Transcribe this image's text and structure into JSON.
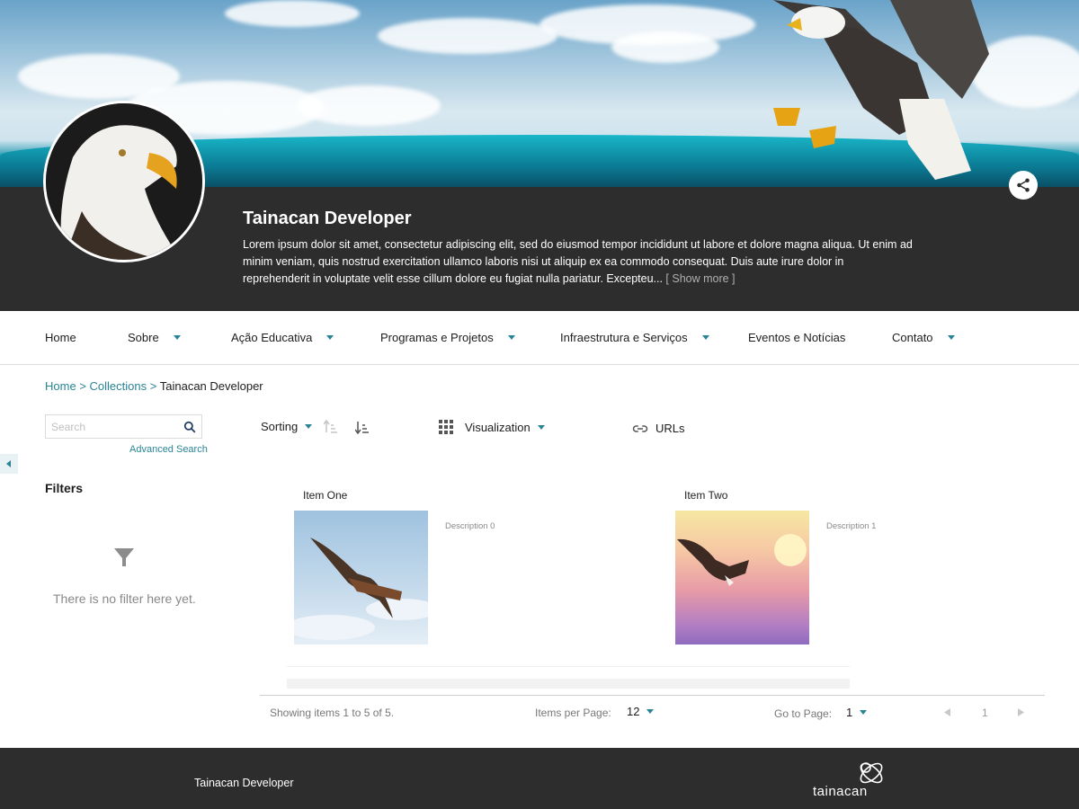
{
  "collection": {
    "title": "Tainacan Developer",
    "description": "Lorem ipsum dolor sit amet, consectetur adipiscing elit, sed do eiusmod tempor incididunt ut labore et dolore magna aliqua. Ut enim ad minim veniam, quis nostrud exercitation ullamco laboris nisi ut aliquip ex ea commodo consequat. Duis aute irure dolor in reprehenderit in voluptate velit esse cillum dolore eu fugiat nulla pariatur. Excepteu...",
    "show_more": "[ Show more ]"
  },
  "nav": {
    "home": "Home",
    "sobre": "Sobre",
    "acao": "Ação Educativa",
    "programas": "Programas e Projetos",
    "infra": "Infraestrutura e Serviços",
    "eventos": "Eventos e Notícias",
    "contato": "Contato"
  },
  "breadcrumb": {
    "home": "Home",
    "collections": "Collections",
    "current": "Tainacan Developer",
    "sep": ">"
  },
  "search": {
    "placeholder": "Search",
    "advanced": "Advanced Search"
  },
  "filters": {
    "title": "Filters",
    "empty": "There is no filter here yet."
  },
  "toolbar": {
    "sorting": "Sorting",
    "visualization": "Visualization",
    "urls": "URLs"
  },
  "items": [
    {
      "title": "Item One",
      "description": "Description 0"
    },
    {
      "title": "Item Two",
      "description": "Description 1"
    }
  ],
  "pagination": {
    "showing": "Showing items 1 to 5 of 5.",
    "per_page_label": "Items per Page:",
    "per_page_value": "12",
    "goto_label": "Go to Page:",
    "goto_value": "1",
    "current_page": "1"
  },
  "footer": {
    "name": "Tainacan Developer",
    "logo_text": "tainacan"
  },
  "colors": {
    "accent": "#298596",
    "header_bg": "#2d2d2d"
  },
  "icons": [
    "share-icon",
    "search-icon",
    "sort-ascending-icon",
    "sort-descending-icon",
    "grid-icon",
    "link-icon",
    "filter-icon",
    "chevron-left-icon",
    "chevron-right-icon",
    "tainacan-logo-icon"
  ]
}
